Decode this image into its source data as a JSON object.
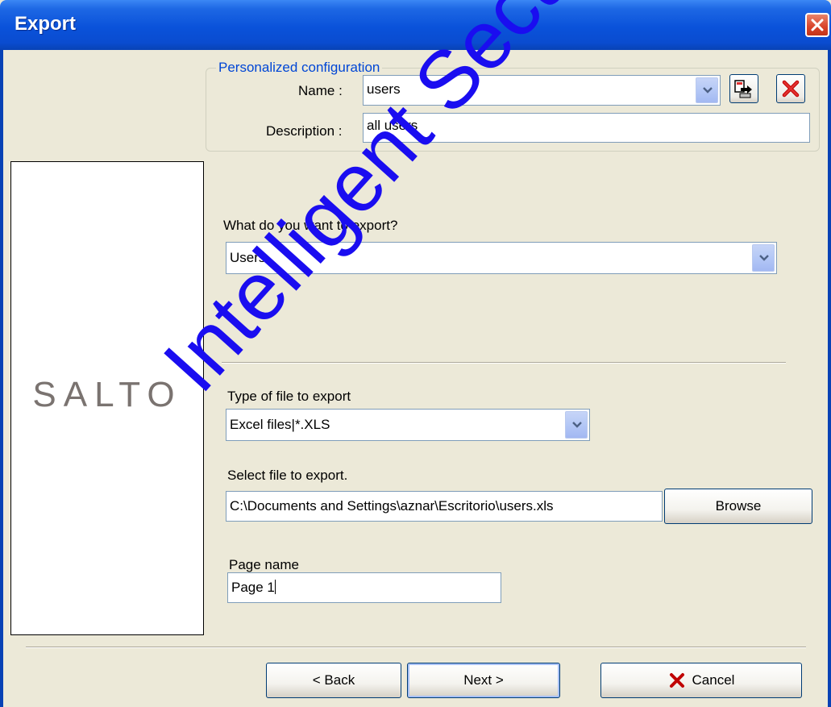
{
  "window": {
    "title": "Export"
  },
  "config": {
    "legend": "Personalized configuration",
    "name_label": "Name :",
    "name_value": "users",
    "description_label": "Description :",
    "description_value": "all users"
  },
  "logo": {
    "text": "SALTO"
  },
  "export_what": {
    "label": "What do you want to export?",
    "value": "Users"
  },
  "file_type": {
    "label": "Type of file to export",
    "value": "Excel files|*.XLS"
  },
  "file_select": {
    "label": "Select file to export.",
    "value": "C:\\Documents and Settings\\aznar\\Escritorio\\users.xls",
    "browse_label": "Browse"
  },
  "page_name": {
    "label": "Page name",
    "value": "Page 1"
  },
  "buttons": {
    "back": "< Back",
    "next": "Next >",
    "cancel": "Cancel"
  },
  "watermark": "Intelligent Security & Fire",
  "colors": {
    "titlebar": "#0A52DA",
    "dialog_bg": "#ECE9D8",
    "legend": "#0046D5",
    "watermark": "#1A0DF0"
  }
}
